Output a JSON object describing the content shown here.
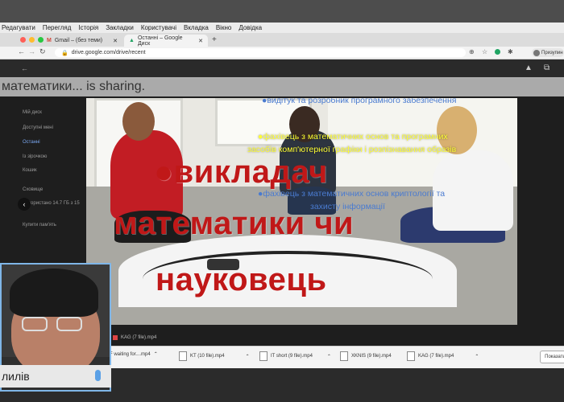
{
  "menubar": {
    "items": [
      "Редагувати",
      "Перегляд",
      "Історія",
      "Закладки",
      "Користувачі",
      "Вкладка",
      "Вікно",
      "Довідка"
    ]
  },
  "tabs": [
    {
      "label": "Gmail – (без теми)",
      "icon": "gmail-icon"
    },
    {
      "label": "Останні – Google Диск",
      "icon": "drive-icon"
    }
  ],
  "address": {
    "url": "drive.google.com/drive/recent",
    "profile_label": "Призупин"
  },
  "drive": {
    "sidebar": [
      "Мій диск",
      "Доступні мені",
      "Останні",
      "Із зірочкою",
      "Кошик",
      "Сховище",
      "Використано 14.7 ГБ з 15",
      "Купити пам'ять"
    ]
  },
  "share_banner": {
    "text": "математики... is sharing."
  },
  "slide": {
    "line1": "●видітук та розробник програмного забезпечення",
    "line2": "●фахівець з математичних основ та програмних",
    "line3": "засобів комп'ютерної графіки і розпізнавання образів",
    "big1": "●викладач",
    "big2": "математики чи",
    "big3": "науковець",
    "line4": "●фахівець з математичних основ криптології та",
    "line5": "захисту інформації"
  },
  "downloads": [
    {
      "name": "AF waiting for....mp4"
    },
    {
      "name": "KT (10 file).mp4"
    },
    {
      "name": "IT short (9 file).mp4"
    },
    {
      "name": "XKNIS (9 file).mp4"
    },
    {
      "name": "KAG (7 file).mp4"
    }
  ],
  "downloads_partial": "KAG (7 file).mp4",
  "show_all_label": "Показати",
  "webcam": {
    "name": "лилів"
  }
}
